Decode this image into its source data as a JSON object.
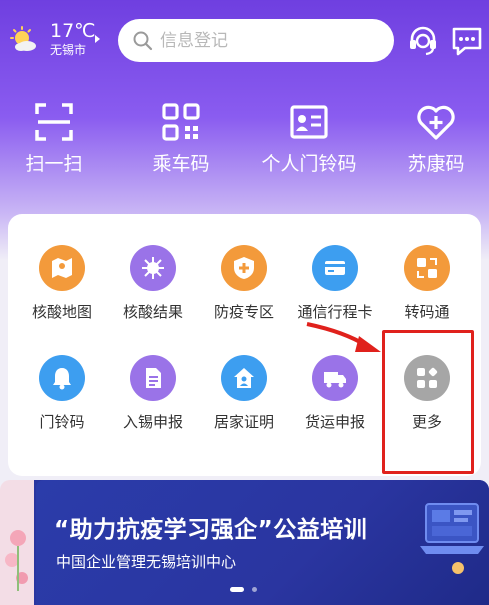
{
  "weather": {
    "temperature": "17℃",
    "city": "无锡市",
    "icon": "sun-cloud-icon"
  },
  "search": {
    "placeholder": "信息登记",
    "icon": "search-icon"
  },
  "header_icons": [
    "customer-service-icon",
    "message-icon"
  ],
  "quick_actions": [
    {
      "label": "扫一扫",
      "icon": "scan-icon"
    },
    {
      "label": "乘车码",
      "icon": "qrcode-icon"
    },
    {
      "label": "个人门铃码",
      "icon": "id-card-icon"
    },
    {
      "label": "苏康码",
      "icon": "health-heart-icon"
    }
  ],
  "services": [
    {
      "label": "核酸地图",
      "icon": "map-icon",
      "color": "#f39a3b"
    },
    {
      "label": "核酸结果",
      "icon": "virus-icon",
      "color": "#9a73e8"
    },
    {
      "label": "防疫专区",
      "icon": "shield-plus-icon",
      "color": "#f39a3b"
    },
    {
      "label": "通信行程卡",
      "icon": "card-icon",
      "color": "#3d9ef0"
    },
    {
      "label": "转码通",
      "icon": "transfer-code-icon",
      "color": "#f39a3b"
    },
    {
      "label": "门铃码",
      "icon": "bell-icon",
      "color": "#3d9ef0"
    },
    {
      "label": "入锡申报",
      "icon": "document-icon",
      "color": "#9a73e8"
    },
    {
      "label": "居家证明",
      "icon": "home-icon",
      "color": "#3d9ef0"
    },
    {
      "label": "货运申报",
      "icon": "truck-icon",
      "color": "#9a73e8"
    },
    {
      "label": "更多",
      "icon": "more-grid-icon",
      "color": "#9e9e9e"
    }
  ],
  "banner": {
    "title": "“助力抗疫学习强企”公益培训",
    "subtitle": "中国企业管理无锡培训中心"
  },
  "colors": {
    "accent": "#7b4ae6",
    "highlight": "#e0211c"
  }
}
